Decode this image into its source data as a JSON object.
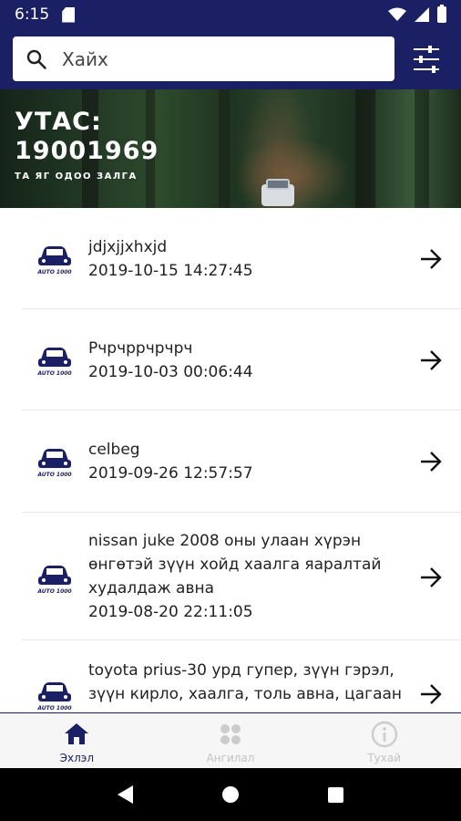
{
  "status_bar": {
    "time": "6:15"
  },
  "search": {
    "placeholder": "Хайх"
  },
  "banner": {
    "title_line1": "УТАС:",
    "title_line2": "19001969",
    "subtitle": "ТА ЯГ ОДОО ЗАЛГА"
  },
  "logo": {
    "text": "AUTO 1000"
  },
  "listings": [
    {
      "title_lines": [
        "jdjxjjxhxjd"
      ],
      "date": "2019-10-15 14:27:45"
    },
    {
      "title_lines": [
        "Рчрчррчрчрч"
      ],
      "date": "2019-10-03 00:06:44"
    },
    {
      "title_lines": [
        "celbeg"
      ],
      "date": "2019-09-26 12:57:57"
    },
    {
      "title_lines": [
        "nissan juke 2008 оны улаан хүрэн",
        "өнгөтэй зүүн хойд хаалга яаралтай",
        "худалдаж авна"
      ],
      "date": "2019-08-20 22:11:05"
    },
    {
      "title_lines": [
        "toyota prius-30 урд гупер, зүүн гэрэл,",
        "зүүн кирло, хаалга, толь авна, цагаан"
      ],
      "date": ""
    }
  ],
  "bottom_nav": {
    "items": [
      {
        "label": "Эхлэл",
        "icon": "home-icon",
        "active": true
      },
      {
        "label": "Ангилал",
        "icon": "category-icon",
        "active": false
      },
      {
        "label": "Тухай",
        "icon": "info-icon",
        "active": false
      }
    ]
  },
  "colors": {
    "primary": "#1b1f64",
    "inactive": "#c4c4c4"
  }
}
